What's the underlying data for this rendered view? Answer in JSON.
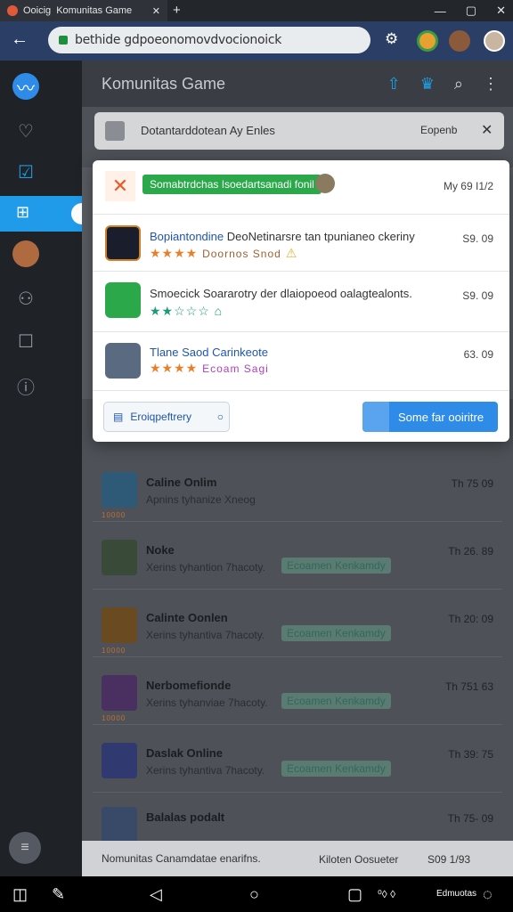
{
  "browser": {
    "tab_title": "Komunitas Game",
    "tab_prefix": "Ooicig",
    "url": "bethide gdpoeonomovdvocionoick",
    "close": "✕",
    "newtab": "+"
  },
  "window": {
    "minimize": "—",
    "maximize": "▢",
    "close": "✕"
  },
  "header": {
    "title": "Komunitas Game"
  },
  "banner": {
    "text": "Dotantarddotean Ay Enles",
    "action": "Eopenb"
  },
  "modal": {
    "top": {
      "chip": "Somabtrdchas Isoedartsanadi fonil",
      "time": "My 69 I1/2"
    },
    "rows": [
      {
        "title": "Bopiantondine",
        "desc": "DeoNetinarsre tan tpunianeo ckeriny",
        "tag": "Doornos Snod",
        "time": "S9. 09"
      },
      {
        "title": "Smoecick Soararotry",
        "desc": "der dlaiopoeod oalagtealonts.",
        "time": "S9. 09"
      },
      {
        "title": "Tlane Saod Carinkeote",
        "tag": "Ecoam Sagi",
        "time": "63. 09"
      }
    ],
    "btn_secondary": "Eroiqpeftrery",
    "btn_primary": "Some far ooiritre"
  },
  "list": [
    {
      "title": "Caline Onlim",
      "sub": "Apnins tyhanize Xneog",
      "time": "Th 75 09",
      "lbl": "10000"
    },
    {
      "title": "Noke",
      "sub": "Xerins tyhantion 7hacoty.",
      "badge": "Ecoamen Kenkamdy",
      "time": "Th 26. 89"
    },
    {
      "title": "Calinte Oonlen",
      "sub": "Xerins tyhantiva 7hacoty.",
      "badge": "Ecoamen Kenkamdy",
      "time": "Th 20: 09",
      "lbl": "10000"
    },
    {
      "title": "Nerbomefionde",
      "sub": "Xerins tyhanviae 7hacoty.",
      "badge": "Ecoamen Kenkamdy",
      "time": "Th 751 63",
      "lbl": "10000"
    },
    {
      "title": "Daslak Online",
      "sub": "Xerins tyhantiva 7hacoty.",
      "badge": "Ecoamen Kenkamdy",
      "time": "Th 39: 75"
    },
    {
      "title": "Balalas podalt",
      "time": "Th 75- 09"
    }
  ],
  "footer": {
    "left": "Nomunitas Canamdatae enarifns.",
    "right": "Kiloten Oosueter",
    "count": "S09 1/93",
    "mini": "Edmuotas"
  },
  "colors": {
    "accent": "#2f8be8",
    "green": "#2aa84a",
    "header": "#3a3e44"
  }
}
